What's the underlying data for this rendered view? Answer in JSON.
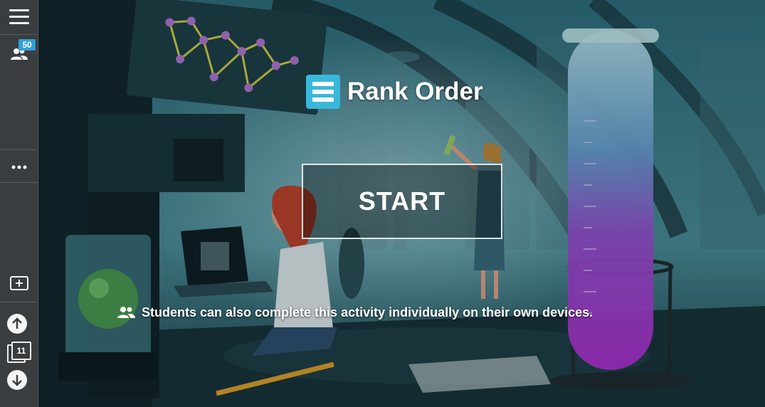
{
  "sidebar": {
    "menu_icon": "hamburger-menu-icon",
    "participants_icon": "participants-icon",
    "participants_count": "50",
    "more_icon": "more-dots-icon",
    "add_icon": "add-slide-icon",
    "up_icon": "arrow-up-icon",
    "down_icon": "arrow-down-icon",
    "pages_icon": "pages-stack-icon",
    "page_count": "11"
  },
  "main": {
    "activity_icon": "rank-order-icon",
    "title": "Rank Order",
    "start_label": "START",
    "notice_icon": "group-icon",
    "notice_text": "Students can also complete this activity individually on their own devices."
  },
  "colors": {
    "accent": "#39b8db",
    "badge": "#2fa1d7",
    "sidebar": "#3a3d40"
  }
}
